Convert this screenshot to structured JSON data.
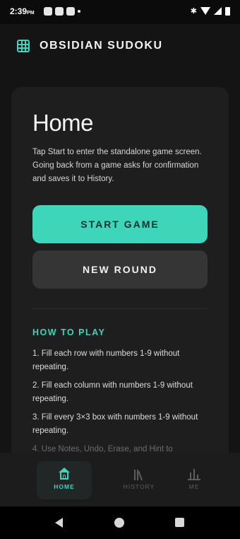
{
  "status_bar": {
    "time": "2:39",
    "am_pm": "PM"
  },
  "app": {
    "title": "OBSIDIAN SUDOKU",
    "accent_color": "#3ed6bb",
    "icon": "grid-icon"
  },
  "home": {
    "heading": "Home",
    "intro": "Tap Start to enter the standalone game screen. Going back from a game asks for confirmation and saves it to History.",
    "start_button": "START GAME",
    "new_round_button": "NEW ROUND",
    "how_to_play_title": "HOW TO PLAY",
    "steps": [
      "1. Fill each row with numbers 1-9 without repeating.",
      "2. Fill each column with numbers 1-9 without repeating.",
      "3. Fill every 3×3 box with numbers 1-9 without repeating.",
      "4. Use Notes, Undo, Erase, and Hint to"
    ]
  },
  "bottom_nav": {
    "items": [
      {
        "label": "HOME",
        "icon": "home-icon",
        "active": true
      },
      {
        "label": "HISTORY",
        "icon": "history-icon",
        "active": false
      },
      {
        "label": "ME",
        "icon": "stats-icon",
        "active": false
      }
    ]
  }
}
